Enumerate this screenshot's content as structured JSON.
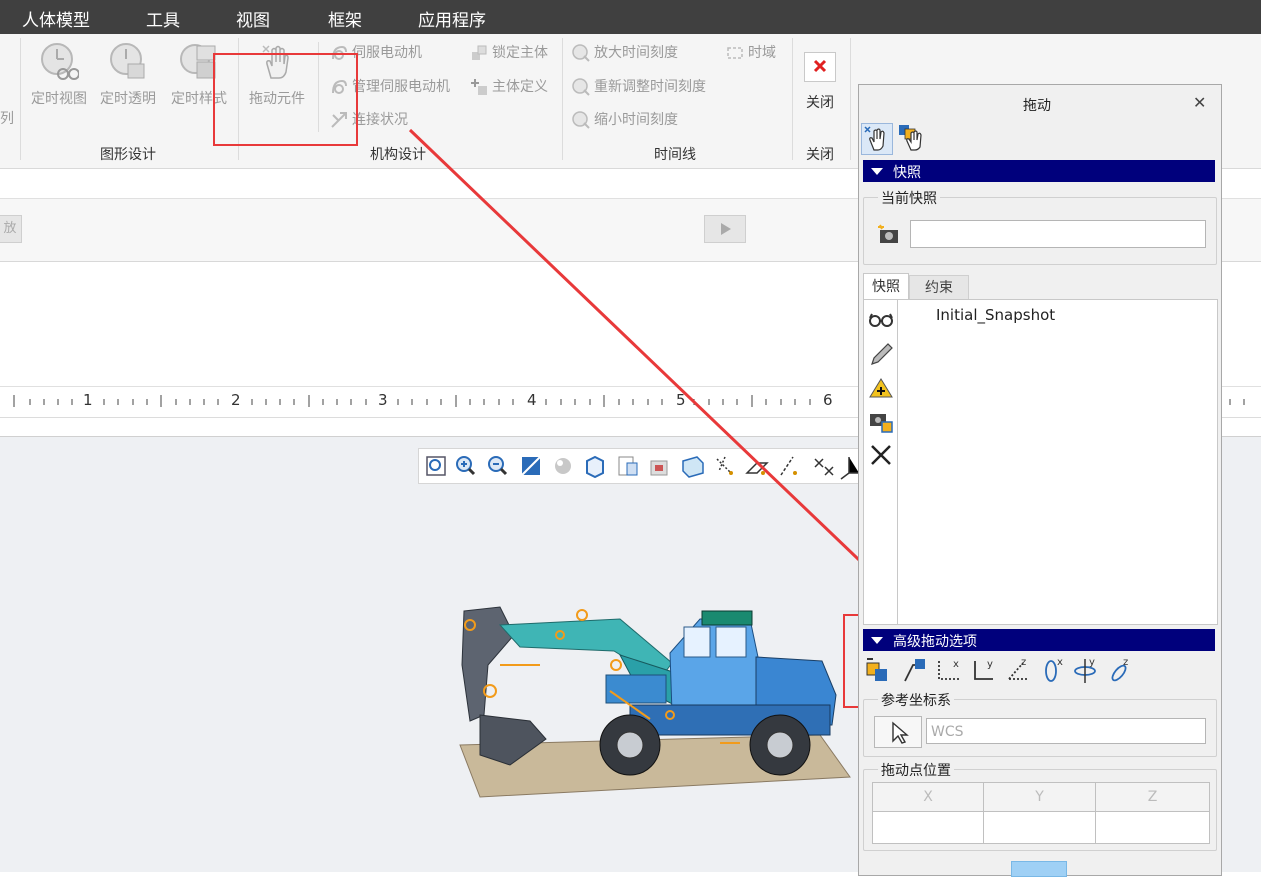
{
  "menu": [
    "人体模型",
    "工具",
    "视图",
    "框架",
    "应用程序"
  ],
  "ribbon": {
    "cut_label": "列",
    "graphic_design": {
      "label": "图形设计",
      "buttons": [
        "定时视图",
        "定时透明",
        "定时样式"
      ]
    },
    "mechanism_design": {
      "label": "机构设计",
      "drag_button": "拖动元件",
      "small_col1": [
        "伺服电动机",
        "管理伺服电动机",
        "连接状况"
      ],
      "small_col2": [
        "锁定主体",
        "主体定义"
      ]
    },
    "timeline": {
      "label": "时间线",
      "small_col1": [
        "放大时间刻度",
        "重新调整时间刻度",
        "缩小时间刻度"
      ],
      "small_col2": [
        "时域"
      ]
    },
    "close": {
      "label": "关闭",
      "group_label": "关闭"
    }
  },
  "timeline_area": {
    "left_button": "放"
  },
  "ruler": {
    "ticks": [
      "1",
      "2",
      "3",
      "4",
      "5",
      "6"
    ]
  },
  "dialog": {
    "title": "拖动",
    "snapshot_section": "快照",
    "current_snapshot_legend": "当前快照",
    "current_snapshot_value": "",
    "tabs": [
      "快照",
      "约束"
    ],
    "snapshots": [
      "Initial_Snapshot"
    ],
    "advanced_section": "高级拖动选项",
    "ref_coord_legend": "参考坐标系",
    "ref_coord_value": "WCS",
    "drag_point_legend": "拖动点位置",
    "xyz_headers": [
      "X",
      "Y",
      "Z"
    ]
  },
  "colors": {
    "menubar": "#404040",
    "section_header": "#00007c",
    "annotation": "#e8393a"
  }
}
